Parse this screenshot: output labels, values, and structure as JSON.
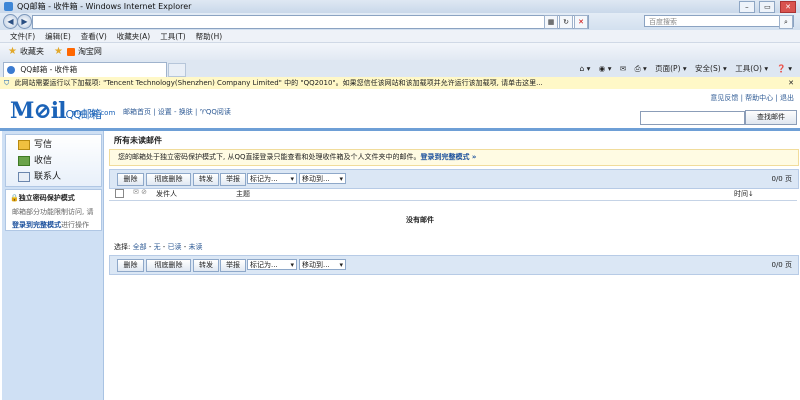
{
  "window": {
    "title": "QQ邮箱 - 收件箱 - Windows Internet Explorer",
    "min": "–",
    "max": "▭",
    "close": "✕"
  },
  "address": {
    "placeholder": "百度搜索",
    "back": "◀",
    "forward": "▶"
  },
  "menu": [
    "文件(F)",
    "编辑(E)",
    "查看(V)",
    "收藏夹(A)",
    "工具(T)",
    "帮助(H)"
  ],
  "favorites": {
    "label": "收藏夹",
    "item": "淘宝网"
  },
  "tab": {
    "title": "QQ邮箱 - 收件箱"
  },
  "commands": [
    "页面(P) ▾",
    "安全(S) ▾",
    "工具(O) ▾",
    "❓ ▾"
  ],
  "infobar": "此网站需要运行以下加载项: \"Tencent Technology(Shenzhen) Company Limited\" 中的 \"QQ2010\"。如果您信任该网站和该加载项并允许运行该加载项, 请单击这里...",
  "mail_header": {
    "logo": "M⊘il",
    "logo_cn": "QQ邮箱",
    "domain": "mail.qq.com",
    "nav": "邮箱首页 | 设置 - 换肤 | ♈QQ阅读",
    "toplinks": "意见反馈 | 帮助中心 | 退出",
    "search_button": "查找邮件"
  },
  "sidebar": {
    "items": [
      "写信",
      "收信",
      "联系人"
    ],
    "security_title": "独立密码保护模式",
    "security_desc": "邮箱部分功能限制访问, 请",
    "security_link": "登录到完整模式",
    "security_tail": "进行操作"
  },
  "main": {
    "folder_title": "所有未读邮件",
    "notice": "您的邮箱处于独立密码保护模式下, 从QQ直接登录只能查看和处理收件箱及个人文件夹中的邮件。",
    "notice_link": "登录到完整模式 »",
    "toolbar": {
      "delete": "删除",
      "perm_delete": "彻底删除",
      "forward": "转发",
      "report": "举报",
      "mark_as": "标记为...",
      "move_to": "移动到...",
      "pager": "0/0 页"
    },
    "columns": {
      "sender": "发件人",
      "subject": "主题",
      "time": "时间↓"
    },
    "empty_text": "没有邮件",
    "select_label": "选择:",
    "select_links": [
      "全部",
      "无",
      "已读",
      "未读"
    ]
  }
}
